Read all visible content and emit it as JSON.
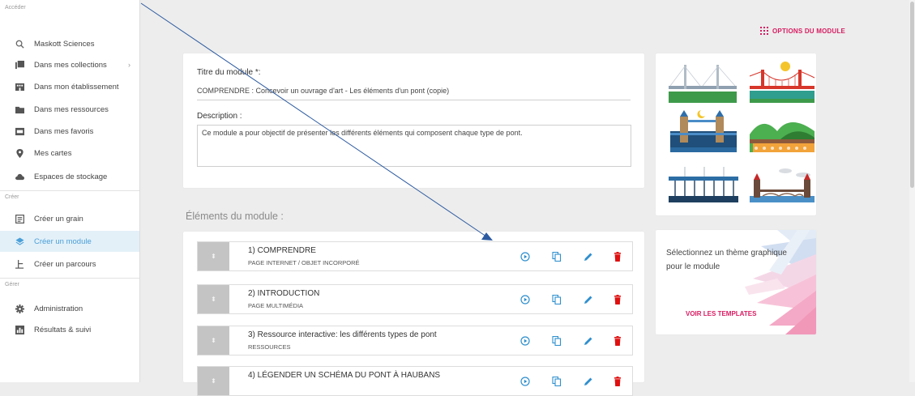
{
  "sidebar": {
    "section_access": "Accéder",
    "section_create": "Créer",
    "section_manage": "Gérer",
    "access_items": [
      {
        "label": "Maskott Sciences",
        "icon": "search-icon"
      },
      {
        "label": "Dans mes collections",
        "icon": "collections-icon",
        "chevron": "›"
      },
      {
        "label": "Dans mon établissement",
        "icon": "building-icon"
      },
      {
        "label": "Dans mes ressources",
        "icon": "folder-icon"
      },
      {
        "label": "Dans mes favoris",
        "icon": "favorites-icon"
      },
      {
        "label": "Mes cartes",
        "icon": "map-pin-icon"
      },
      {
        "label": "Espaces de stockage",
        "icon": "cloud-icon"
      }
    ],
    "create_items": [
      {
        "label": "Créer un grain",
        "icon": "grain-icon"
      },
      {
        "label": "Créer un module",
        "icon": "layers-icon",
        "active": true
      },
      {
        "label": "Créer un parcours",
        "icon": "path-icon"
      }
    ],
    "manage_items": [
      {
        "label": "Administration",
        "icon": "gear-icon"
      },
      {
        "label": "Résultats & suivi",
        "icon": "chart-icon"
      }
    ]
  },
  "header": {
    "options_label": "OPTIONS DU MODULE",
    "options_icon": "grid-icon"
  },
  "form": {
    "title_label": "Titre du module *:",
    "title_value": "COMPRENDRE : Concevoir un ouvrage d'art - Les éléments d'un pont (copie)",
    "description_label": "Description :",
    "description_value": "Ce module a pour objectif de présenter les différents éléments qui composent chaque type de pont."
  },
  "elements": {
    "section_title": "Éléments du module :",
    "rows": [
      {
        "title": "1) COMPRENDRE",
        "subtitle": "PAGE INTERNET / OBJET INCORPORÉ"
      },
      {
        "title": "2) INTRODUCTION",
        "subtitle": "PAGE MULTIMÉDIA"
      },
      {
        "title": "3) Ressource interactive: les différents types de pont",
        "subtitle": "RESSOURCES"
      },
      {
        "title": "4) LÉGENDER UN SCHÉMA DU PONT À HAUBANS",
        "subtitle": ""
      }
    ]
  },
  "theme": {
    "text": "Sélectionnez un thème graphique pour le module",
    "link": "VOIR LES TEMPLATES"
  },
  "colors": {
    "accent_pink": "#d81b60",
    "accent_blue": "#2f8fce",
    "delete_red": "#e01010",
    "active_bg": "#e3f0f8"
  }
}
